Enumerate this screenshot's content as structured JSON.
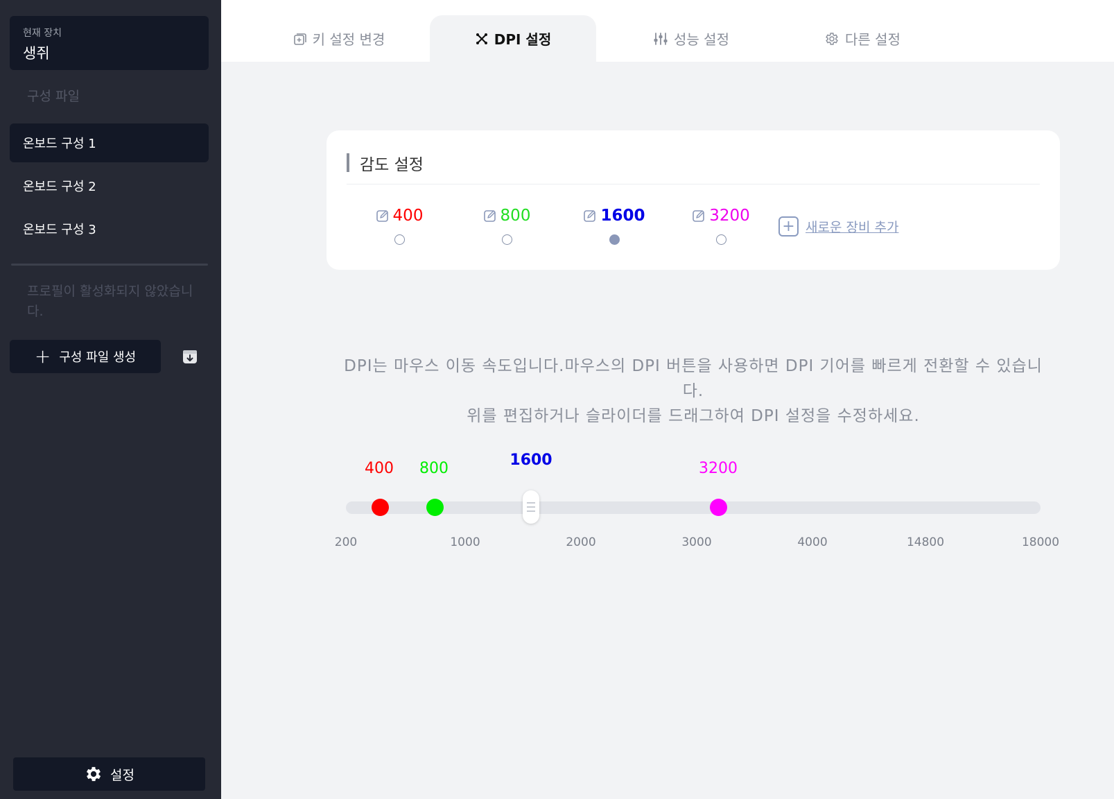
{
  "sidebar": {
    "device_label": "현재 장치",
    "device_name": "생쥐",
    "section_label": "구성 파일",
    "profiles": [
      "온보드 구성 1",
      "온보드 구성 2",
      "온보드 구성 3"
    ],
    "active_profile_index": 0,
    "inactive_note": "프로필이 활성화되지 않았습니다.",
    "create_button": "구성 파일 생성",
    "settings_button": "설정"
  },
  "tabs": [
    {
      "label": "키 설정 변경",
      "icon": "key-settings-icon",
      "active": false
    },
    {
      "label": "DPI 설정",
      "icon": "dpi-icon",
      "active": true
    },
    {
      "label": "성능 설정",
      "icon": "sliders-icon",
      "active": false
    },
    {
      "label": "다른 설정",
      "icon": "gear-icon",
      "active": false
    }
  ],
  "sensitivity": {
    "title": "감도 설정",
    "levels": [
      {
        "value": "400",
        "color": "#ff0000",
        "selected": false
      },
      {
        "value": "800",
        "color": "#22dd22",
        "selected": false
      },
      {
        "value": "1600",
        "color": "#0000e6",
        "selected": true
      },
      {
        "value": "3200",
        "color": "#ee00ee",
        "selected": false
      }
    ],
    "add_device": "새로운 장비 추가"
  },
  "description": {
    "line1": "DPI는 마우스 이동 속도입니다.마우스의 DPI 버튼을 사용하면 DPI 기어를 빠르게 전환할 수 있습니다.",
    "line2": "위를 편집하거나 슬라이더를 드래그하여 DPI 설정을 수정하세요."
  },
  "slider": {
    "ticks": [
      "200",
      "1000",
      "2000",
      "3000",
      "4000",
      "14800",
      "18000"
    ],
    "markers": [
      {
        "label": "400",
        "color": "#ff0000",
        "selected": false
      },
      {
        "label": "800",
        "color": "#00ee00",
        "selected": false
      },
      {
        "label": "1600",
        "color": "#0000e6",
        "selected": true
      },
      {
        "label": "3200",
        "color": "#ff00ff",
        "selected": false
      }
    ]
  }
}
